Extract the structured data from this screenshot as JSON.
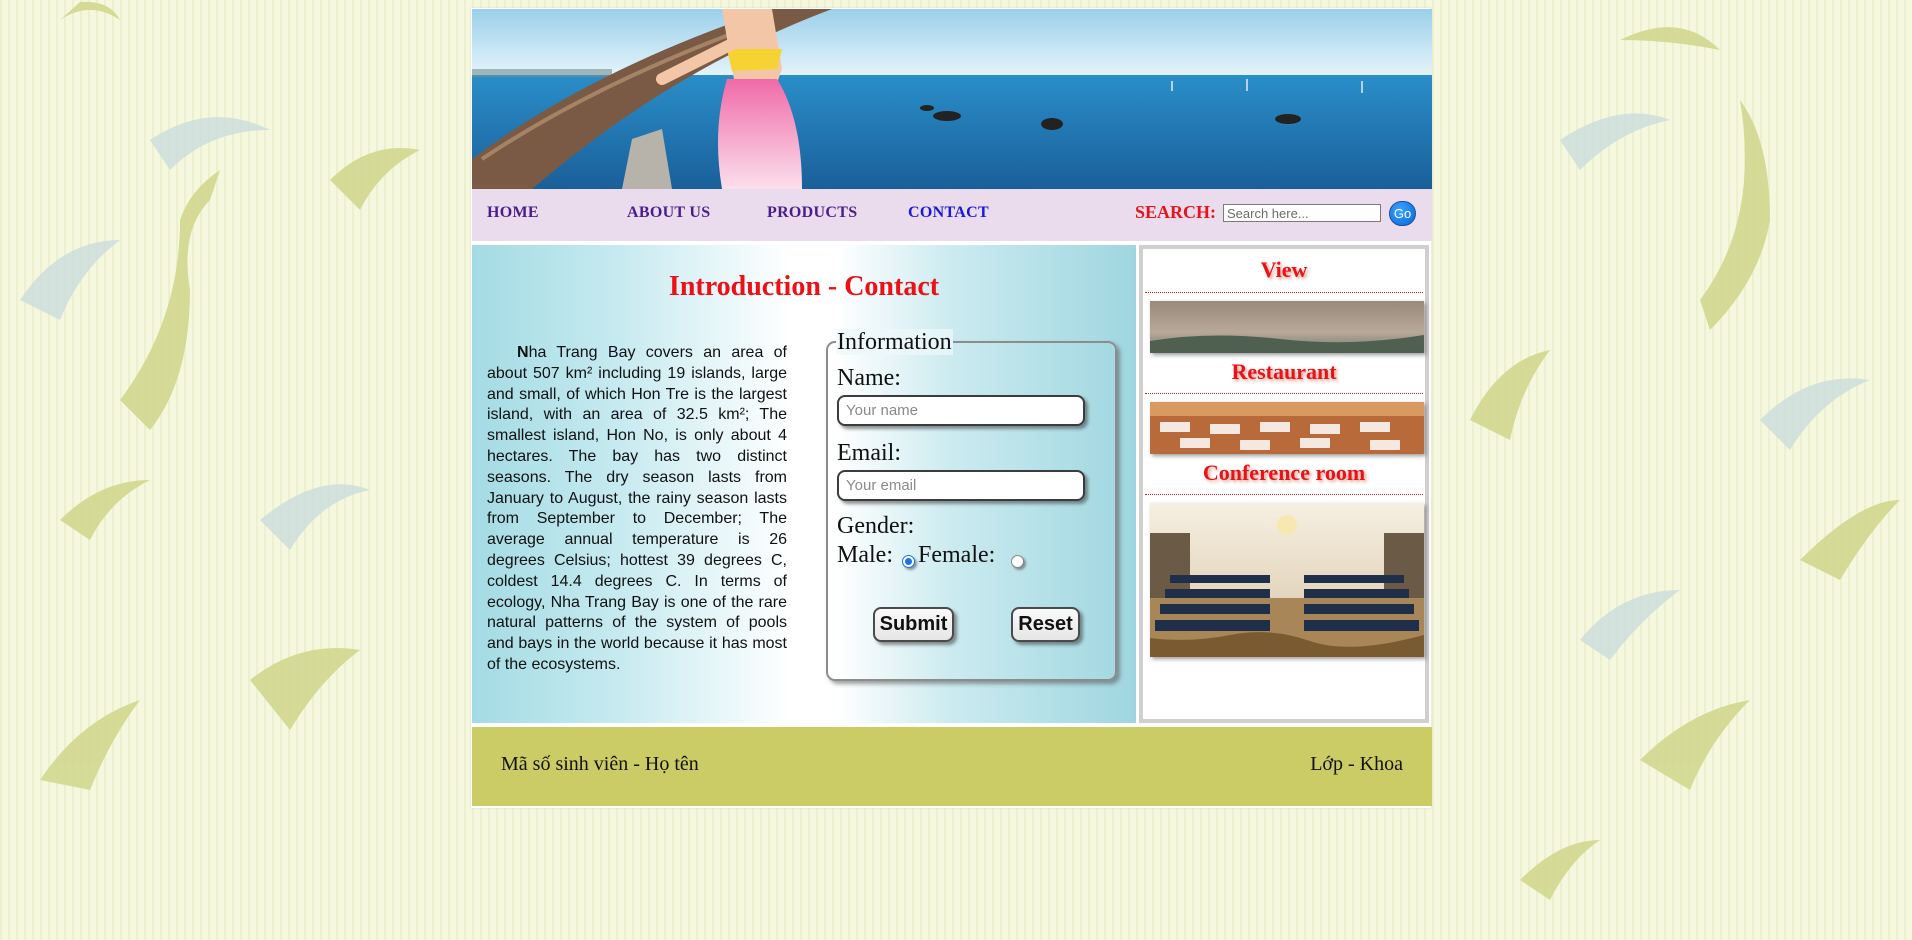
{
  "nav": {
    "items": [
      {
        "label": "HOME"
      },
      {
        "label": "ABOUT US"
      },
      {
        "label": "PRODUCTS"
      },
      {
        "label": "CONTACT"
      }
    ],
    "search_label": "SEARCH:",
    "search_placeholder": "Search here...",
    "go_label": "Go"
  },
  "main": {
    "title": "Introduction - Contact",
    "intro_first_letter": "N",
    "intro_text": "ha Trang Bay covers an area of about 507 km² including 19 islands, large and small, of which Hon Tre is the largest island, with an area of  32.5 km²; The smallest island, Hon No, is only about 4 hectares. The bay has two distinct seasons. The dry season lasts from January to August, the rainy season lasts from September to December; The average annual temperature is 26 degrees Celsius; hottest 39 degrees C, coldest 14.4 degrees C. In terms of ecology, Nha Trang Bay is one of the rare natural patterns of the system of pools and bays in the world because it has most of the ecosystems."
  },
  "form": {
    "legend": "Information",
    "name_label": "Name:",
    "name_placeholder": "Your name",
    "email_label": "Email:",
    "email_placeholder": "Your email",
    "gender_label": "Gender:",
    "male_label": "Male:",
    "female_label": "Female:",
    "selected_gender": "male",
    "submit_label": "Submit",
    "reset_label": "Reset"
  },
  "sidebar": {
    "sections": [
      {
        "title": "View"
      },
      {
        "title": "Restaurant"
      },
      {
        "title": "Conference room"
      }
    ]
  },
  "footer": {
    "left": "Mã số sinh viên - Họ tên",
    "right": "Lớp - Khoa"
  },
  "colors": {
    "nav_text": "#4a1d8a",
    "nav_active": "#1a1ad2",
    "title_red": "#ea1118",
    "footer_bg": "#cccc66",
    "nav_bg": "#eadcec"
  }
}
